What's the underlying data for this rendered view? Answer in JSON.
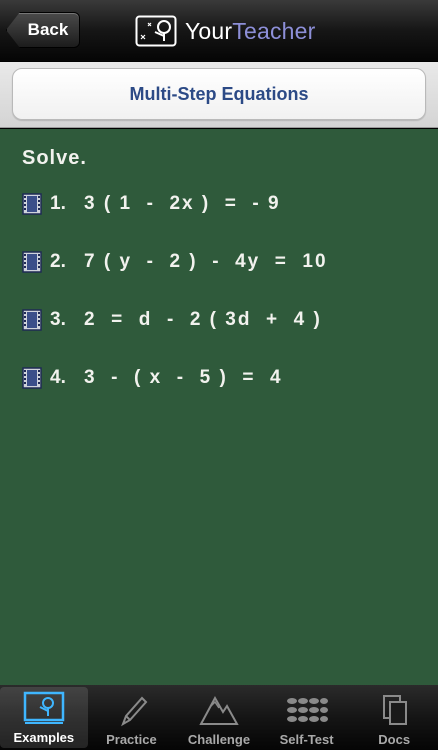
{
  "navbar": {
    "back_label": "Back",
    "brand_part1": "Your",
    "brand_part2": "Teacher",
    "logo_icon": "yourteacher-logo-icon"
  },
  "title": "Multi-Step Equations",
  "board": {
    "heading": "Solve.",
    "problems": [
      {
        "number": "1.",
        "equation": "3 ( 1  -  2x )  =  - 9"
      },
      {
        "number": "2.",
        "equation": "7 ( y  -  2 )  -  4y  =  10"
      },
      {
        "number": "3.",
        "equation": "2  =  d  -  2 ( 3d  +  4 )"
      },
      {
        "number": "4.",
        "equation": "3  -  ( x  -  5 )  =  4"
      }
    ],
    "problem_icon": "film-icon"
  },
  "tabs": [
    {
      "label": "Examples",
      "icon": "whiteboard-icon",
      "active": true
    },
    {
      "label": "Practice",
      "icon": "pencil-icon",
      "active": false
    },
    {
      "label": "Challenge",
      "icon": "mountain-icon",
      "active": false
    },
    {
      "label": "Self-Test",
      "icon": "keypad-icon",
      "active": false
    },
    {
      "label": "Docs",
      "icon": "documents-icon",
      "active": false
    }
  ],
  "colors": {
    "board": "#2f5a3b",
    "title_text": "#2c4a86",
    "brand_accent": "#8d8fd8",
    "chalk": "#f2f2ee"
  }
}
